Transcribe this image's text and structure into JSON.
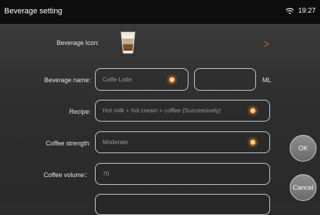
{
  "status_bar": {
    "title": "Beverage setting",
    "time": "19:27"
  },
  "icon_row": {
    "label": "Beverage Icon:",
    "icon": "cafe-latte-cup-icon",
    "arrow_icon": "chevron-right-icon"
  },
  "name_row": {
    "label": "Beverage name:",
    "value": "Caffe Latte",
    "volume_value": "",
    "unit": "ML"
  },
  "recipe_row": {
    "label": "Recipe:",
    "value": "Hot milk + hot cream + coffee (Successively)"
  },
  "strength_row": {
    "label": "Coffee strength:",
    "value": "Moderate"
  },
  "volume_row": {
    "label": "Coffee volume：",
    "value": "70"
  },
  "buttons": {
    "ok": "OK",
    "cancel": "Cancel"
  },
  "colors": {
    "accent": "#e87b18",
    "status_bar": "#0d0d0d",
    "background": "#2e2e2e"
  }
}
